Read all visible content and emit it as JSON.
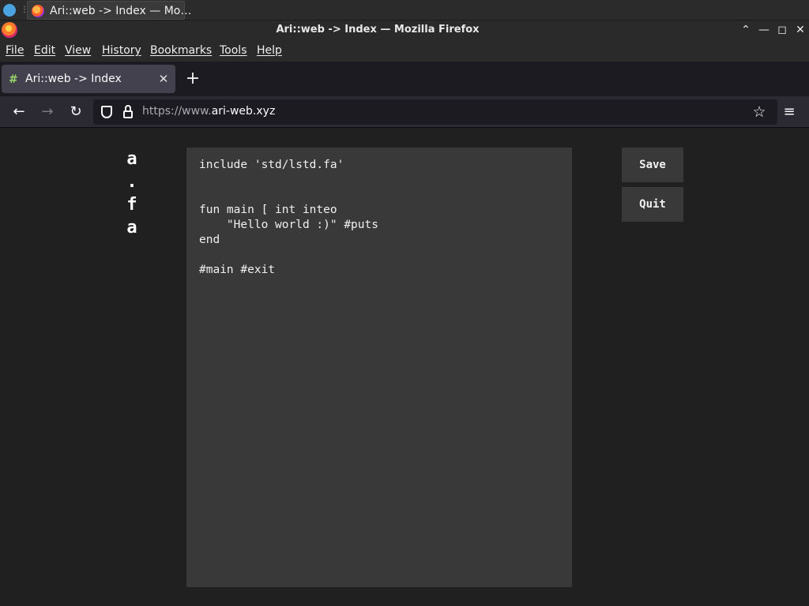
{
  "taskbar": {
    "task_label": "Ari::web -> Index — Mo…",
    "separator": "⋮"
  },
  "window": {
    "title": "Ari::web -> Index — Mozilla Firefox",
    "controls": {
      "up": "⌃",
      "minimize": "—",
      "maximize": "◻",
      "close": "✕"
    }
  },
  "menubar": {
    "items": [
      "File",
      "Edit",
      "View",
      "History",
      "Bookmarks",
      "Tools",
      "Help"
    ]
  },
  "tabs": [
    {
      "label": "Ari::web -> Index",
      "icon": "#",
      "close": "✕"
    }
  ],
  "new_tab": "+",
  "navigation": {
    "back": "←",
    "forward": "→",
    "reload": "↻",
    "url_prefix": "https://www.",
    "url_host": "ari-web.xyz",
    "bookmark_star": "☆",
    "app_menu": "≡"
  },
  "page": {
    "logo": [
      "a",
      ".",
      "f",
      "a"
    ],
    "editor_content": "include 'std/lstd.fa'\n\n\nfun main [ int inteo\n    \"Hello world :)\" #puts\nend\n\n#main #exit",
    "save_label": "Save",
    "quit_label": "Quit"
  },
  "colors": {
    "page_background": "#202020",
    "editor_background": "#393939",
    "tab_active": "#42414d",
    "toolbar": "#2b2a33"
  }
}
